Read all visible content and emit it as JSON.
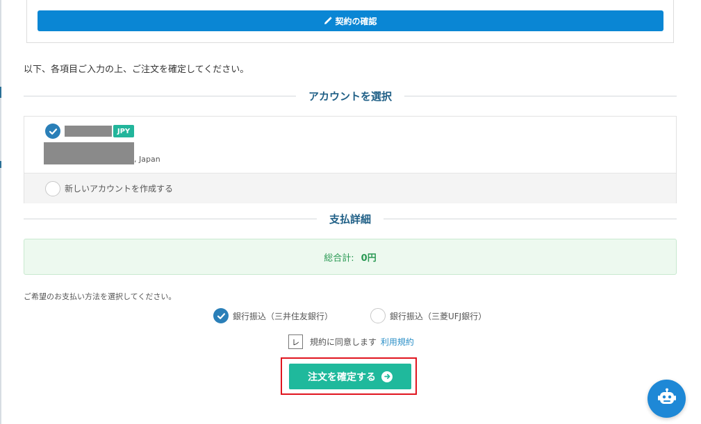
{
  "contract": {
    "confirm_label": "契約の確認"
  },
  "instruction": "以下、各項目ご入力の上、ご注文を確定してください。",
  "account_section": {
    "title": "アカウントを選択",
    "selected_account": {
      "currency_badge": "JPY",
      "address_suffix": ", Japan"
    },
    "new_account_label": "新しいアカウントを作成する"
  },
  "payment_section": {
    "title": "支払詳細",
    "total_label": "総合計:",
    "total_value": "0円",
    "method_instruction": "ご希望のお支払い方法を選択してください。",
    "methods": [
      {
        "label": "銀行振込（三井住友銀行）",
        "selected": true
      },
      {
        "label": "銀行振込（三菱UFJ銀行）",
        "selected": false
      }
    ]
  },
  "agreement": {
    "checkbox_mark": "レ",
    "text": "規約に同意します",
    "link": "利用規約"
  },
  "submit": {
    "label": "注文を確定する"
  },
  "colors": {
    "primary_blue": "#0a86d4",
    "teal": "#1fb99c",
    "heading_blue": "#1f5f86",
    "highlight_red": "#e0141e"
  }
}
